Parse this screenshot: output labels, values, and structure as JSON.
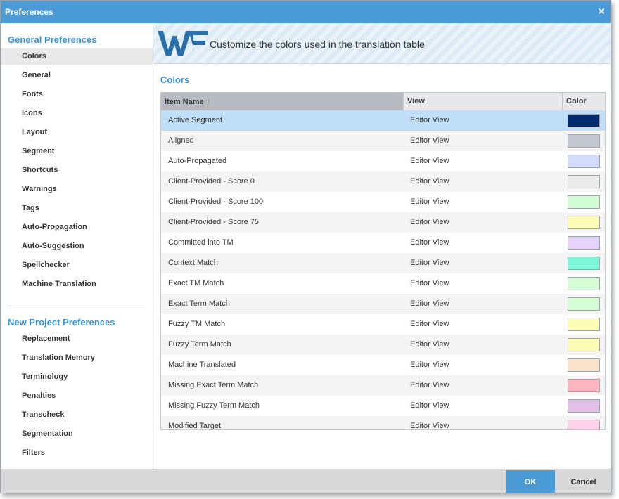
{
  "window": {
    "title": "Preferences",
    "close_label": "✕"
  },
  "sidebar": {
    "general_title": "General Preferences",
    "general_items": [
      {
        "label": "Colors"
      },
      {
        "label": "General"
      },
      {
        "label": "Fonts"
      },
      {
        "label": "Icons"
      },
      {
        "label": "Layout"
      },
      {
        "label": "Segment"
      },
      {
        "label": "Shortcuts"
      },
      {
        "label": "Warnings"
      },
      {
        "label": "Tags"
      },
      {
        "label": "Auto-Propagation"
      },
      {
        "label": "Auto-Suggestion"
      },
      {
        "label": "Spellchecker"
      },
      {
        "label": "Machine Translation"
      }
    ],
    "selected": "Colors",
    "project_title": "New Project Preferences",
    "project_items": [
      {
        "label": "Replacement"
      },
      {
        "label": "Translation Memory"
      },
      {
        "label": "Terminology"
      },
      {
        "label": "Penalties"
      },
      {
        "label": "Transcheck"
      },
      {
        "label": "Segmentation"
      },
      {
        "label": "Filters"
      }
    ]
  },
  "banner": {
    "logo": "wf-logo",
    "text": "Customize the colors used in the translation table"
  },
  "main": {
    "heading": "Colors"
  },
  "table": {
    "columns": {
      "name": "Item Name",
      "view": "View",
      "color": "Color"
    },
    "sort_icon": "sort-up-arrow-icon",
    "rows": [
      {
        "name": "Active Segment",
        "view": "Editor View",
        "color": "#002b6e",
        "selected": true
      },
      {
        "name": "Aligned",
        "view": "Editor View",
        "color": "#c3c8d0"
      },
      {
        "name": "Auto-Propagated",
        "view": "Editor View",
        "color": "#d3dcfd"
      },
      {
        "name": "Client-Provided - Score 0",
        "view": "Editor View",
        "color": "#ebebeb"
      },
      {
        "name": "Client-Provided - Score 100",
        "view": "Editor View",
        "color": "#d2fdd3"
      },
      {
        "name": "Client-Provided - Score 75",
        "view": "Editor View",
        "color": "#fefdb8"
      },
      {
        "name": "Committed into TM",
        "view": "Editor View",
        "color": "#e5d3fc"
      },
      {
        "name": "Context Match",
        "view": "Editor View",
        "color": "#7cf6d6"
      },
      {
        "name": "Exact TM Match",
        "view": "Editor View",
        "color": "#d4fdd5"
      },
      {
        "name": "Exact Term Match",
        "view": "Editor View",
        "color": "#d4fdd5"
      },
      {
        "name": "Fuzzy TM Match",
        "view": "Editor View",
        "color": "#fefdb8"
      },
      {
        "name": "Fuzzy Term Match",
        "view": "Editor View",
        "color": "#fefdb8"
      },
      {
        "name": "Machine Translated",
        "view": "Editor View",
        "color": "#fee3cc"
      },
      {
        "name": "Missing Exact Term Match",
        "view": "Editor View",
        "color": "#fdb5c0"
      },
      {
        "name": "Missing Fuzzy Term Match",
        "view": "Editor View",
        "color": "#e4bfe6"
      },
      {
        "name": "Modified Target",
        "view": "Editor View",
        "color": "#fed3ea"
      }
    ]
  },
  "footer": {
    "ok_label": "OK",
    "cancel_label": "Cancel"
  },
  "colors": {
    "accent": "#4a9bd6",
    "heading": "#3a93d4",
    "selected_row": "#bfdff8"
  }
}
